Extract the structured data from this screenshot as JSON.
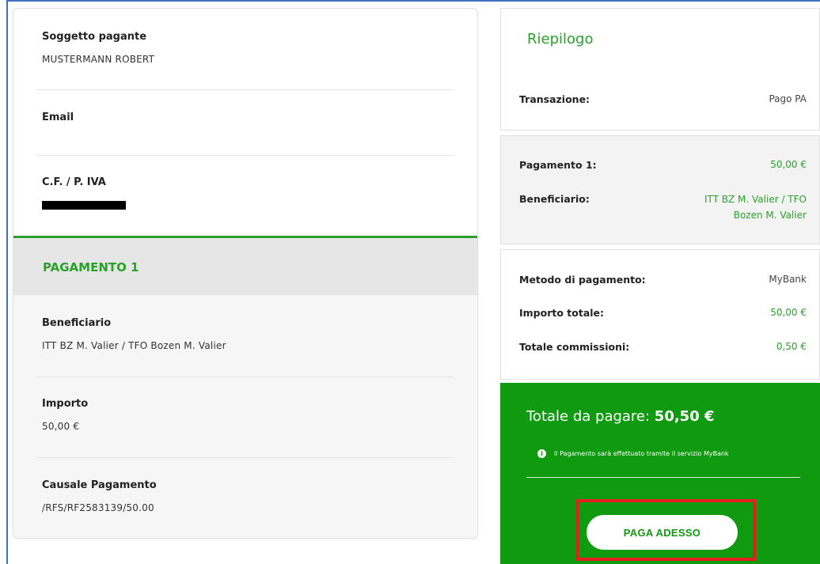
{
  "payer": {
    "payer_label": "Soggetto pagante",
    "payer_value": "MUSTERMANN ROBERT",
    "email_label": "Email",
    "email_value": "",
    "cf_label": "C.F. / P. IVA"
  },
  "payment": {
    "section_title": "PAGAMENTO 1",
    "beneficiary_label": "Beneficiario",
    "beneficiary_value": "ITT BZ M. Valier / TFO Bozen M. Valier",
    "amount_label": "Importo",
    "amount_value": "50,00 €",
    "reason_label": "Causale Pagamento",
    "reason_value": "/RFS/RF2583139/50.00"
  },
  "summary": {
    "title": "Riepilogo",
    "transaction_label": "Transazione:",
    "transaction_value": "Pago PA",
    "payment1_label": "Pagamento 1:",
    "payment1_value": "50,00 €",
    "beneficiary_label": "Beneficiario:",
    "beneficiary_line1": "ITT BZ M. Valier / TFO",
    "beneficiary_line2": "Bozen M. Valier",
    "method_label": "Metodo di pagamento:",
    "method_value": "MyBank",
    "total_amount_label": "Importo totale:",
    "total_amount_value": "50,00 €",
    "fees_label": "Totale commissioni:",
    "fees_value": "0,50 €",
    "to_pay_label": "Totale da pagare:",
    "to_pay_value": "50,50 €",
    "info_icon": "i",
    "info_text": "Il Pagamento sarà effettuato tramite il servizio MyBank",
    "pay_button": "PAGA ADESSO"
  },
  "colors": {
    "accent_green": "#2aa12a",
    "total_bg": "#0f9a0f",
    "highlight_red": "#e41f1f",
    "window_border": "#3f6fbd"
  }
}
